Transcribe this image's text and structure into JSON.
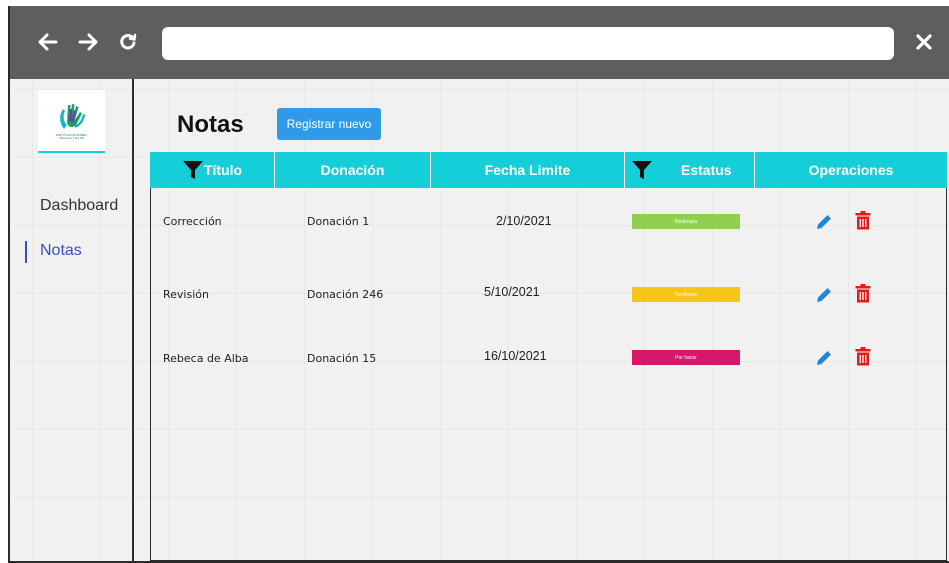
{
  "browser": {
    "back_icon": "arrow-left-icon",
    "forward_icon": "arrow-right-icon",
    "reload_icon": "reload-icon",
    "close_icon": "close-icon",
    "address_value": ""
  },
  "sidebar": {
    "logo_text": "INSTITUCIÓN DABEL",
    "logo_sub": "Villa Nuevo Y Seo IAP",
    "items": [
      {
        "label": "Dashboard",
        "active": false
      },
      {
        "label": "Notas",
        "active": true
      }
    ]
  },
  "header": {
    "title": "Notas",
    "register_label": "Registrar nuevo"
  },
  "table": {
    "columns": [
      "Título",
      "Donación",
      "Fecha Limite",
      "Estatus",
      "Operaciones"
    ],
    "rows": [
      {
        "titulo": "Corrección",
        "donacion": "Donación 1",
        "fecha": "2/10/2021",
        "estatus": "Realizada",
        "estatus_color": "#8fd14f"
      },
      {
        "titulo": "Revisión",
        "donacion": "Donación 246",
        "fecha": "5/10/2021",
        "estatus": "Pendiente",
        "estatus_color": "#f5c518"
      },
      {
        "titulo": "Rebeca de Alba",
        "donacion": "Donación 15",
        "fecha": "16/10/2021",
        "estatus": "Por hacer",
        "estatus_color": "#d6176b"
      }
    ]
  },
  "colors": {
    "header_bg": "#14cfd7",
    "accent": "#2f9be8",
    "edit_icon": "#1f87d9",
    "delete_icon": "#e21b1b"
  }
}
